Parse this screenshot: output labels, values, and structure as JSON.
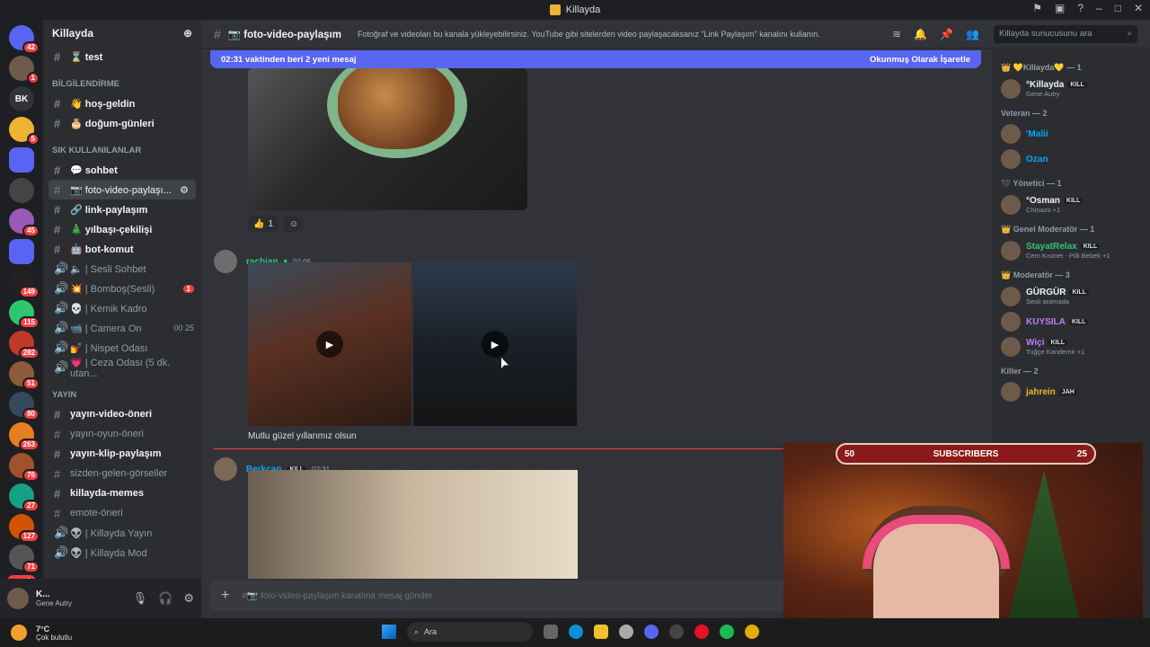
{
  "window": {
    "title": "Killayda"
  },
  "guilds": {
    "badges": [
      "42",
      "1",
      "",
      "5",
      "",
      "",
      "45",
      "",
      "149",
      "115",
      "282",
      "51",
      "80",
      "263",
      "76",
      "27",
      "127",
      "71"
    ],
    "dm_label": "BK",
    "new_label": "YENİ"
  },
  "sidebar": {
    "server_name": "Killayda",
    "channels": [
      {
        "name": "⌛ test",
        "type": "text",
        "state": "unread"
      },
      {
        "name": "BİLGİLENDİRME",
        "type": "category"
      },
      {
        "name": "👋 hoş-geldin",
        "type": "text",
        "state": "unread"
      },
      {
        "name": "🎂 doğum-günleri",
        "type": "text",
        "state": "unread"
      },
      {
        "name": "SIK KULLANILANLAR",
        "type": "category"
      },
      {
        "name": "💬 sohbet",
        "type": "text",
        "state": "unread"
      },
      {
        "name": "📷 foto-video-paylaşı...",
        "type": "text",
        "state": "active"
      },
      {
        "name": "🔗 link-paylaşım",
        "type": "text",
        "state": "unread"
      },
      {
        "name": "🎄 yılbaşı-çekilişi",
        "type": "text",
        "state": "unread"
      },
      {
        "name": "🤖 bot-komut",
        "type": "text",
        "state": "unread"
      },
      {
        "name": "🔈 | Sesli Sohbet",
        "type": "voice"
      },
      {
        "name": "💥 | Bomboş(Sesli)",
        "type": "voice",
        "badge": "1"
      },
      {
        "name": "💀 | Kemik Kadro",
        "type": "voice"
      },
      {
        "name": "📹 | Camera On",
        "type": "voice",
        "counts": "00 25"
      },
      {
        "name": "💅 | Nispet Odası",
        "type": "voice"
      },
      {
        "name": "💗 | Ceza Odası (5 dk. utan...",
        "type": "voice"
      },
      {
        "name": "YAYIN",
        "type": "category"
      },
      {
        "name": "yayın-video-öneri",
        "type": "text",
        "state": "unread"
      },
      {
        "name": "yayın-oyun-öneri",
        "type": "text",
        "state": "read"
      },
      {
        "name": "yayın-klip-paylaşım",
        "type": "text",
        "state": "unread"
      },
      {
        "name": "sizden-gelen-görseller",
        "type": "text",
        "state": "read"
      },
      {
        "name": "killayda-memes",
        "type": "text",
        "state": "unread"
      },
      {
        "name": "emote-öneri",
        "type": "text",
        "state": "read"
      },
      {
        "name": "👽 | Killayda Yayın",
        "type": "voice"
      },
      {
        "name": "👽 | Killayda Mod",
        "type": "voice"
      }
    ]
  },
  "user_panel": {
    "name": "K...",
    "status": "Gene Autry"
  },
  "header": {
    "channel_name": "📷 foto-video-paylaşım",
    "topic": "Fotoğraf ve videoları bu kanala yükleyebilirsiniz. YouTube gibi sitelerden video paylaşacaksanız \"Link Paylaşım\" kanalını kullanın.",
    "search_placeholder": "Killayda sunucusunu ara"
  },
  "new_messages_bar": {
    "text": "02:31 vaktinden beri 2 yeni mesaj",
    "action": "Okunmuş Olarak İşaretle"
  },
  "messages": [
    {
      "reaction_emoji": "👍",
      "reaction_count": "1"
    },
    {
      "author": "rachian",
      "time": "02:06",
      "text": "Mutlu güzel yıllarımız olsun",
      "color": "#2dc770"
    },
    {
      "author": "Berkcan",
      "tag": "KILL",
      "time": "02:31",
      "color": "#00a8fc"
    }
  ],
  "composer": {
    "placeholder": "#📷 foto-video-paylaşım kanalına mesaj gönder"
  },
  "members": {
    "groups": [
      {
        "title": "👑 💛Killayda💛 — 1",
        "items": [
          {
            "name": "°Killayda",
            "status": "Gene Autry",
            "color": "#f2f3f5",
            "tag": "KILL"
          }
        ]
      },
      {
        "title": "Veteran — 2",
        "items": [
          {
            "name": "'Malii",
            "status": "",
            "color": "#00a8fc"
          },
          {
            "name": "Ozan",
            "status": "",
            "color": "#00a8fc"
          }
        ]
      },
      {
        "title": "🖤 Yönetici — 1",
        "items": [
          {
            "name": "°Osman",
            "status": "Chinazo +1",
            "color": "#f2f3f5",
            "tag": "KILL"
          }
        ]
      },
      {
        "title": "👑 Genel Moderatör — 1",
        "items": [
          {
            "name": "StayatRelax",
            "status": "Cem Kısmet - Pilli Bebek +1",
            "color": "#2dc770",
            "tag": "KILL"
          }
        ]
      },
      {
        "title": "👑 Moderatör — 3",
        "items": [
          {
            "name": "GÜRGÜR",
            "status": "Sesli aramada",
            "color": "#f2f3f5",
            "tag": "KILL"
          },
          {
            "name": "KUYSILA",
            "status": "",
            "color": "#c27cff",
            "tag": "KILL"
          },
          {
            "name": "Wiçi",
            "status": "Tuğçe Kandemir +1",
            "color": "#c27cff",
            "tag": "KILL"
          }
        ]
      },
      {
        "title": "Killer — 2",
        "items": [
          {
            "name": "jahrein",
            "status": "",
            "color": "#f0b232",
            "tag": "JAH"
          }
        ]
      }
    ]
  },
  "webcam": {
    "subs_left": "50",
    "subs_label": "SUBSCRIBERS",
    "subs_right": "25"
  },
  "taskbar": {
    "temp": "7°C",
    "weather": "Çok bulutlu",
    "search": "Ara"
  }
}
